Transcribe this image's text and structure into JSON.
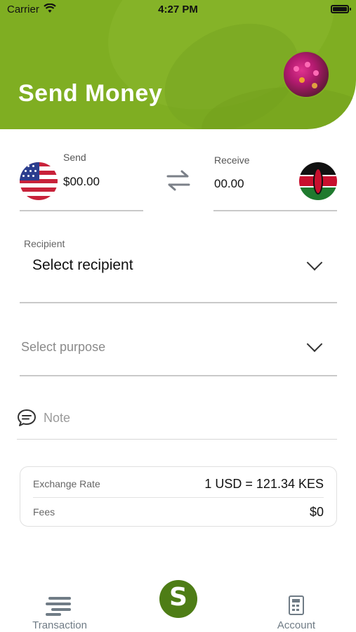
{
  "status_bar": {
    "carrier": "Carrier",
    "time": "4:27 PM"
  },
  "header": {
    "title": "Send Money"
  },
  "send": {
    "label": "Send",
    "amount": "$00.00",
    "currency_flag": "us-flag-icon"
  },
  "receive": {
    "label": "Receive",
    "amount": "00.00",
    "currency_flag": "kenya-flag-icon"
  },
  "recipient": {
    "label": "Recipient",
    "value": "Select recipient"
  },
  "purpose": {
    "placeholder": "Select purpose"
  },
  "note": {
    "placeholder": "Note"
  },
  "info": {
    "exchange_rate_label": "Exchange Rate",
    "exchange_rate_value": "1 USD = 121.34 KES",
    "fees_label": "Fees",
    "fees_value": "$0"
  },
  "nav": {
    "transaction_label": "Transaction",
    "account_label": "Account",
    "center_logo": "S"
  },
  "colors": {
    "brand_green": "#7fae22",
    "logo_green": "#4e7d16",
    "nav_gray": "#707c86"
  }
}
